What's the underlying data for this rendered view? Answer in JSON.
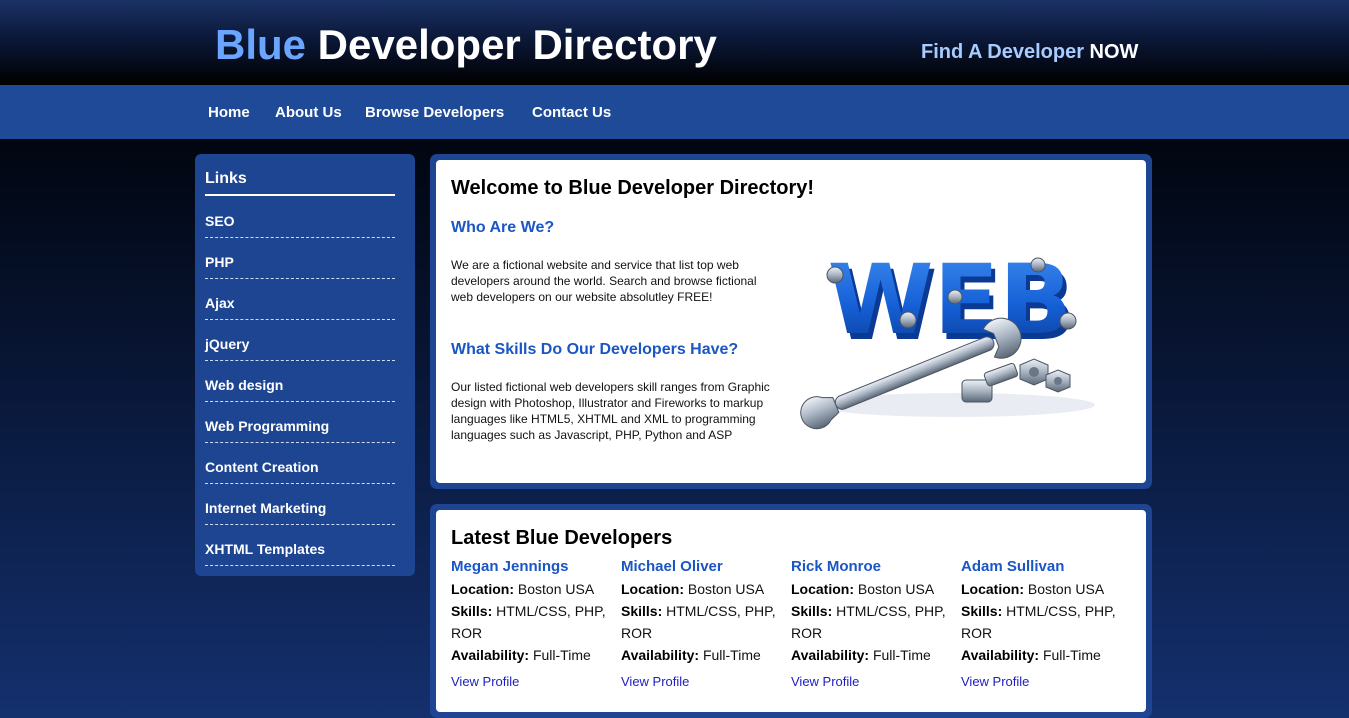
{
  "header": {
    "title_accent": "Blue",
    "title_rest": " Developer Directory",
    "tagline_main": "Find A Developer ",
    "tagline_emphasis": "NOW"
  },
  "nav": {
    "items": [
      "Home",
      "About Us",
      "Browse Developers",
      "Contact Us"
    ]
  },
  "sidebar": {
    "title": "Links",
    "items": [
      "SEO",
      "PHP",
      "Ajax",
      "jQuery",
      "Web design",
      "Web Programming",
      "Content Creation",
      "Internet Marketing",
      "XHTML Templates"
    ]
  },
  "welcome": {
    "heading": "Welcome to Blue Developer Directory!",
    "who_heading": "Who Are We?",
    "who_text": "We are a fictional website and service that list top web developers around the world. Search and browse fictional web developers on our website absolutley FREE!",
    "skills_heading": "What Skills Do Our Developers Have?",
    "skills_text": "Our listed fictional web developers skill ranges from Graphic design with Photoshop, Illustrator and Fireworks to markup languages like HTML5, XHTML and XML to programming languages such as Javascript, PHP, Python and ASP",
    "graphic_text": "WEB"
  },
  "latest": {
    "heading": "Latest Blue Developers",
    "location_label": "Location:",
    "skills_label": "Skills:",
    "availability_label": "Availability:",
    "link_label": "View Profile",
    "developers": [
      {
        "name": "Megan Jennings",
        "location": "Boston USA",
        "skills": "HTML/CSS, PHP, ROR",
        "availability": "Full-Time"
      },
      {
        "name": "Michael Oliver",
        "location": "Boston USA",
        "skills": "HTML/CSS, PHP, ROR",
        "availability": "Full-Time"
      },
      {
        "name": "Rick Monroe",
        "location": "Boston USA",
        "skills": "HTML/CSS, PHP, ROR",
        "availability": "Full-Time"
      },
      {
        "name": "Adam Sullivan",
        "location": "Boston USA",
        "skills": "HTML/CSS, PHP, ROR",
        "availability": "Full-Time"
      }
    ]
  },
  "colors": {
    "accent_blue": "#1a56c4",
    "nav_blue": "#1e4a98",
    "title_light_blue": "#6aa6ff",
    "link_blue": "#1d1dc0"
  }
}
